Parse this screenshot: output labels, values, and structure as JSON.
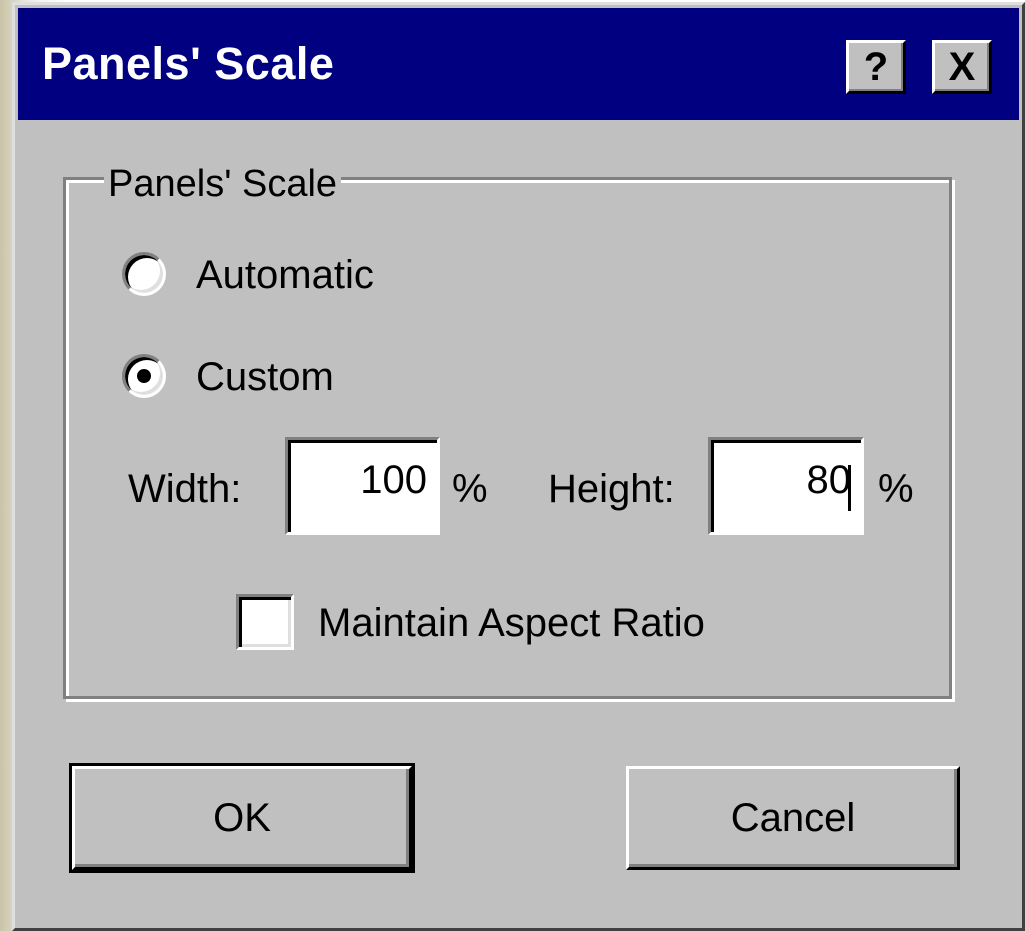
{
  "window": {
    "title": "Panels' Scale",
    "help_label": "?",
    "close_label": "X"
  },
  "group": {
    "label": "Panels' Scale",
    "mode": {
      "automatic_label": "Automatic",
      "custom_label": "Custom",
      "selected": "Custom"
    },
    "width": {
      "label": "Width:",
      "value": "100",
      "unit": "%"
    },
    "height": {
      "label": "Height:",
      "value": "80",
      "unit": "%"
    },
    "aspect": {
      "label": "Maintain Aspect Ratio",
      "checked": false
    }
  },
  "buttons": {
    "ok_label": "OK",
    "cancel_label": "Cancel"
  },
  "colors": {
    "titlebar": "#000080",
    "face": "#c0c0c0"
  }
}
